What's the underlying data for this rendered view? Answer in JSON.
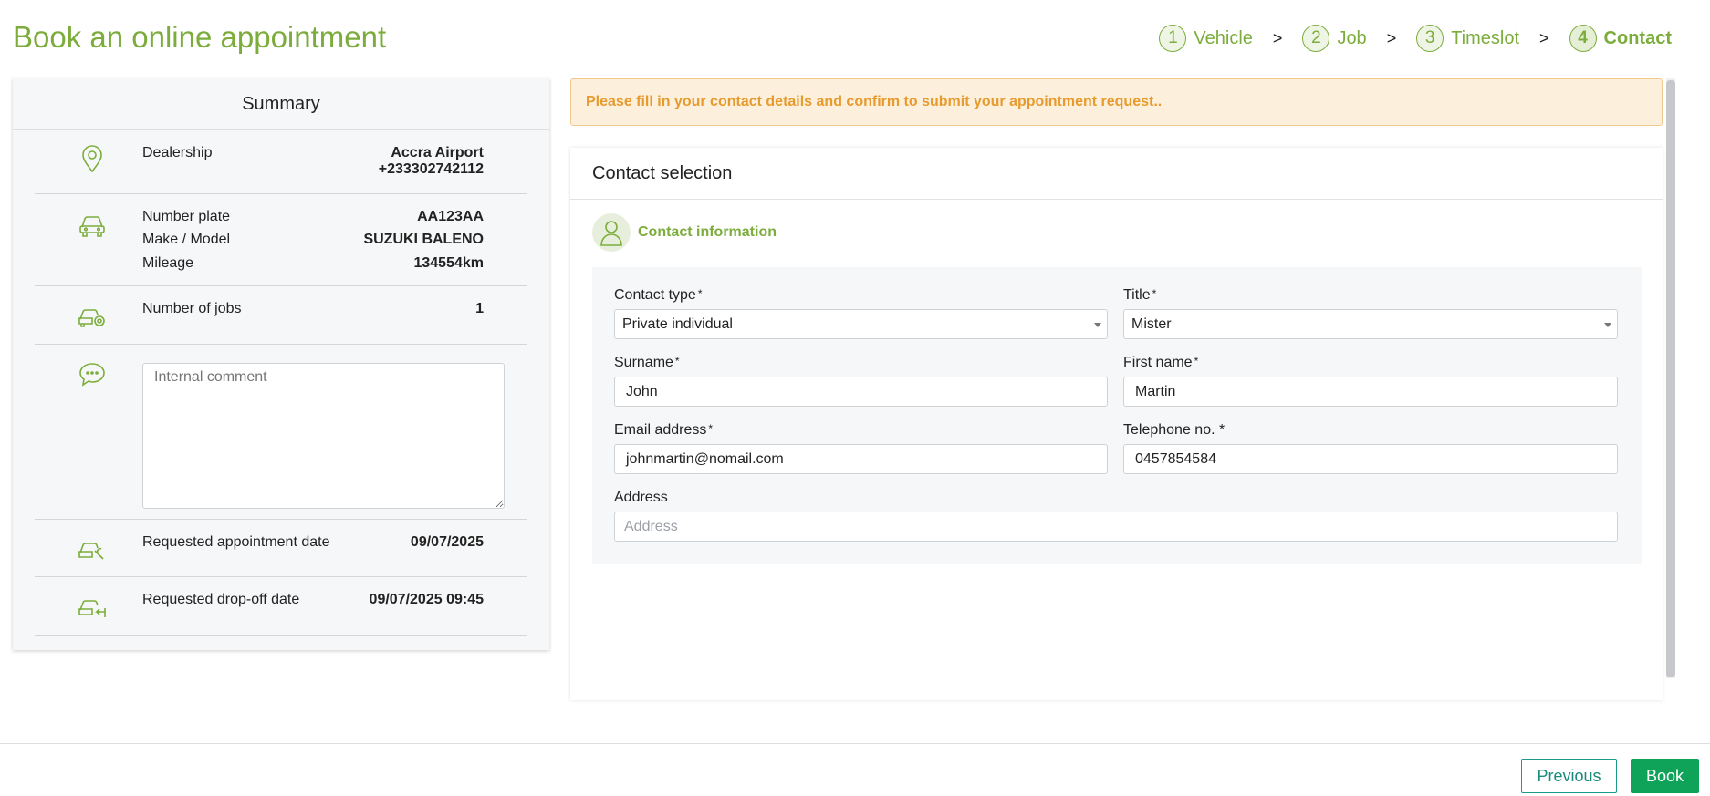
{
  "page": {
    "title": "Book an online appointment"
  },
  "stepper": {
    "steps": [
      {
        "num": "1",
        "label": "Vehicle"
      },
      {
        "num": "2",
        "label": "Job"
      },
      {
        "num": "3",
        "label": "Timeslot"
      },
      {
        "num": "4",
        "label": "Contact"
      }
    ],
    "separator": ">"
  },
  "summary": {
    "title": "Summary",
    "dealership": {
      "label": "Dealership",
      "name": "Accra Airport",
      "phone": "+233302742112"
    },
    "vehicle": {
      "plate_label": "Number plate",
      "plate": "AA123AA",
      "model_label": "Make / Model",
      "model": "SUZUKI BALENO",
      "mileage_label": "Mileage",
      "mileage": "134554km"
    },
    "jobs": {
      "label": "Number of jobs",
      "value": "1"
    },
    "comment": {
      "placeholder": "Internal comment"
    },
    "appointment": {
      "label": "Requested appointment date",
      "value": "09/07/2025"
    },
    "dropoff": {
      "label": "Requested drop-off date",
      "value": "09/07/2025 09:45"
    }
  },
  "alert": {
    "text": "Please fill in your contact details and confirm to submit your appointment request.."
  },
  "contact": {
    "panel_title": "Contact selection",
    "section_title": "Contact information",
    "fields": {
      "contact_type": {
        "label": "Contact type",
        "value": "Private individual"
      },
      "title": {
        "label": "Title",
        "value": "Mister"
      },
      "surname": {
        "label": "Surname",
        "value": "John"
      },
      "first_name": {
        "label": "First name",
        "value": "Martin"
      },
      "email": {
        "label": "Email address",
        "value": "johnmartin@nomail.com"
      },
      "telephone": {
        "label": "Telephone no. *",
        "value": "0457854584"
      },
      "address": {
        "label": "Address",
        "placeholder": "Address"
      }
    },
    "required_mark": "*"
  },
  "footer": {
    "previous_label": "Previous",
    "book_label": "Book"
  },
  "colors": {
    "accent": "#7cad3c",
    "alert_bg": "#fcf0dc",
    "alert_text": "#e79b2e",
    "book": "#0fa35a"
  }
}
